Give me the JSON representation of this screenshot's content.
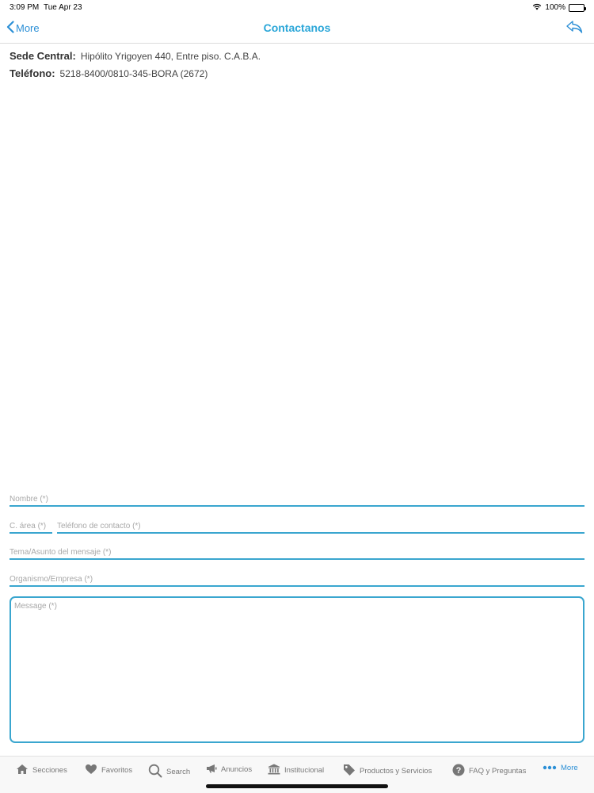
{
  "status": {
    "time": "3:09 PM",
    "date": "Tue Apr 23",
    "battery": "100%"
  },
  "nav": {
    "back_label": "More",
    "title": "Contactanos"
  },
  "info": {
    "hq_label": "Sede Central:",
    "hq_value": "Hipólito Yrigoyen 440, Entre piso. C.A.B.A.",
    "phone_label": "Teléfono:",
    "phone_value": "5218-8400/0810-345-BORA (2672)"
  },
  "form": {
    "name_placeholder": "Nombre (*)",
    "area_placeholder": "C. área (*)",
    "phone_placeholder": "Teléfono de contacto (*)",
    "subject_placeholder": "Tema/Asunto del mensaje (*)",
    "org_placeholder": "Organismo/Empresa (*)",
    "message_placeholder": "Message (*)"
  },
  "tabs": [
    {
      "label": "Secciones",
      "icon": "home-icon"
    },
    {
      "label": "Favoritos",
      "icon": "heart-icon"
    },
    {
      "label": "Search",
      "icon": "search-icon"
    },
    {
      "label": "Anuncios",
      "icon": "megaphone-icon"
    },
    {
      "label": "Institucional",
      "icon": "institution-icon"
    },
    {
      "label": "Productos y Servicios",
      "icon": "tag-icon"
    },
    {
      "label": "FAQ y Preguntas",
      "icon": "question-icon"
    },
    {
      "label": "More",
      "icon": "more-icon",
      "active": true
    }
  ],
  "colors": {
    "accent": "#2aa6d8",
    "field_border": "#3aa6cf",
    "tab_inactive": "#777777",
    "tab_active": "#2b8fd6"
  }
}
